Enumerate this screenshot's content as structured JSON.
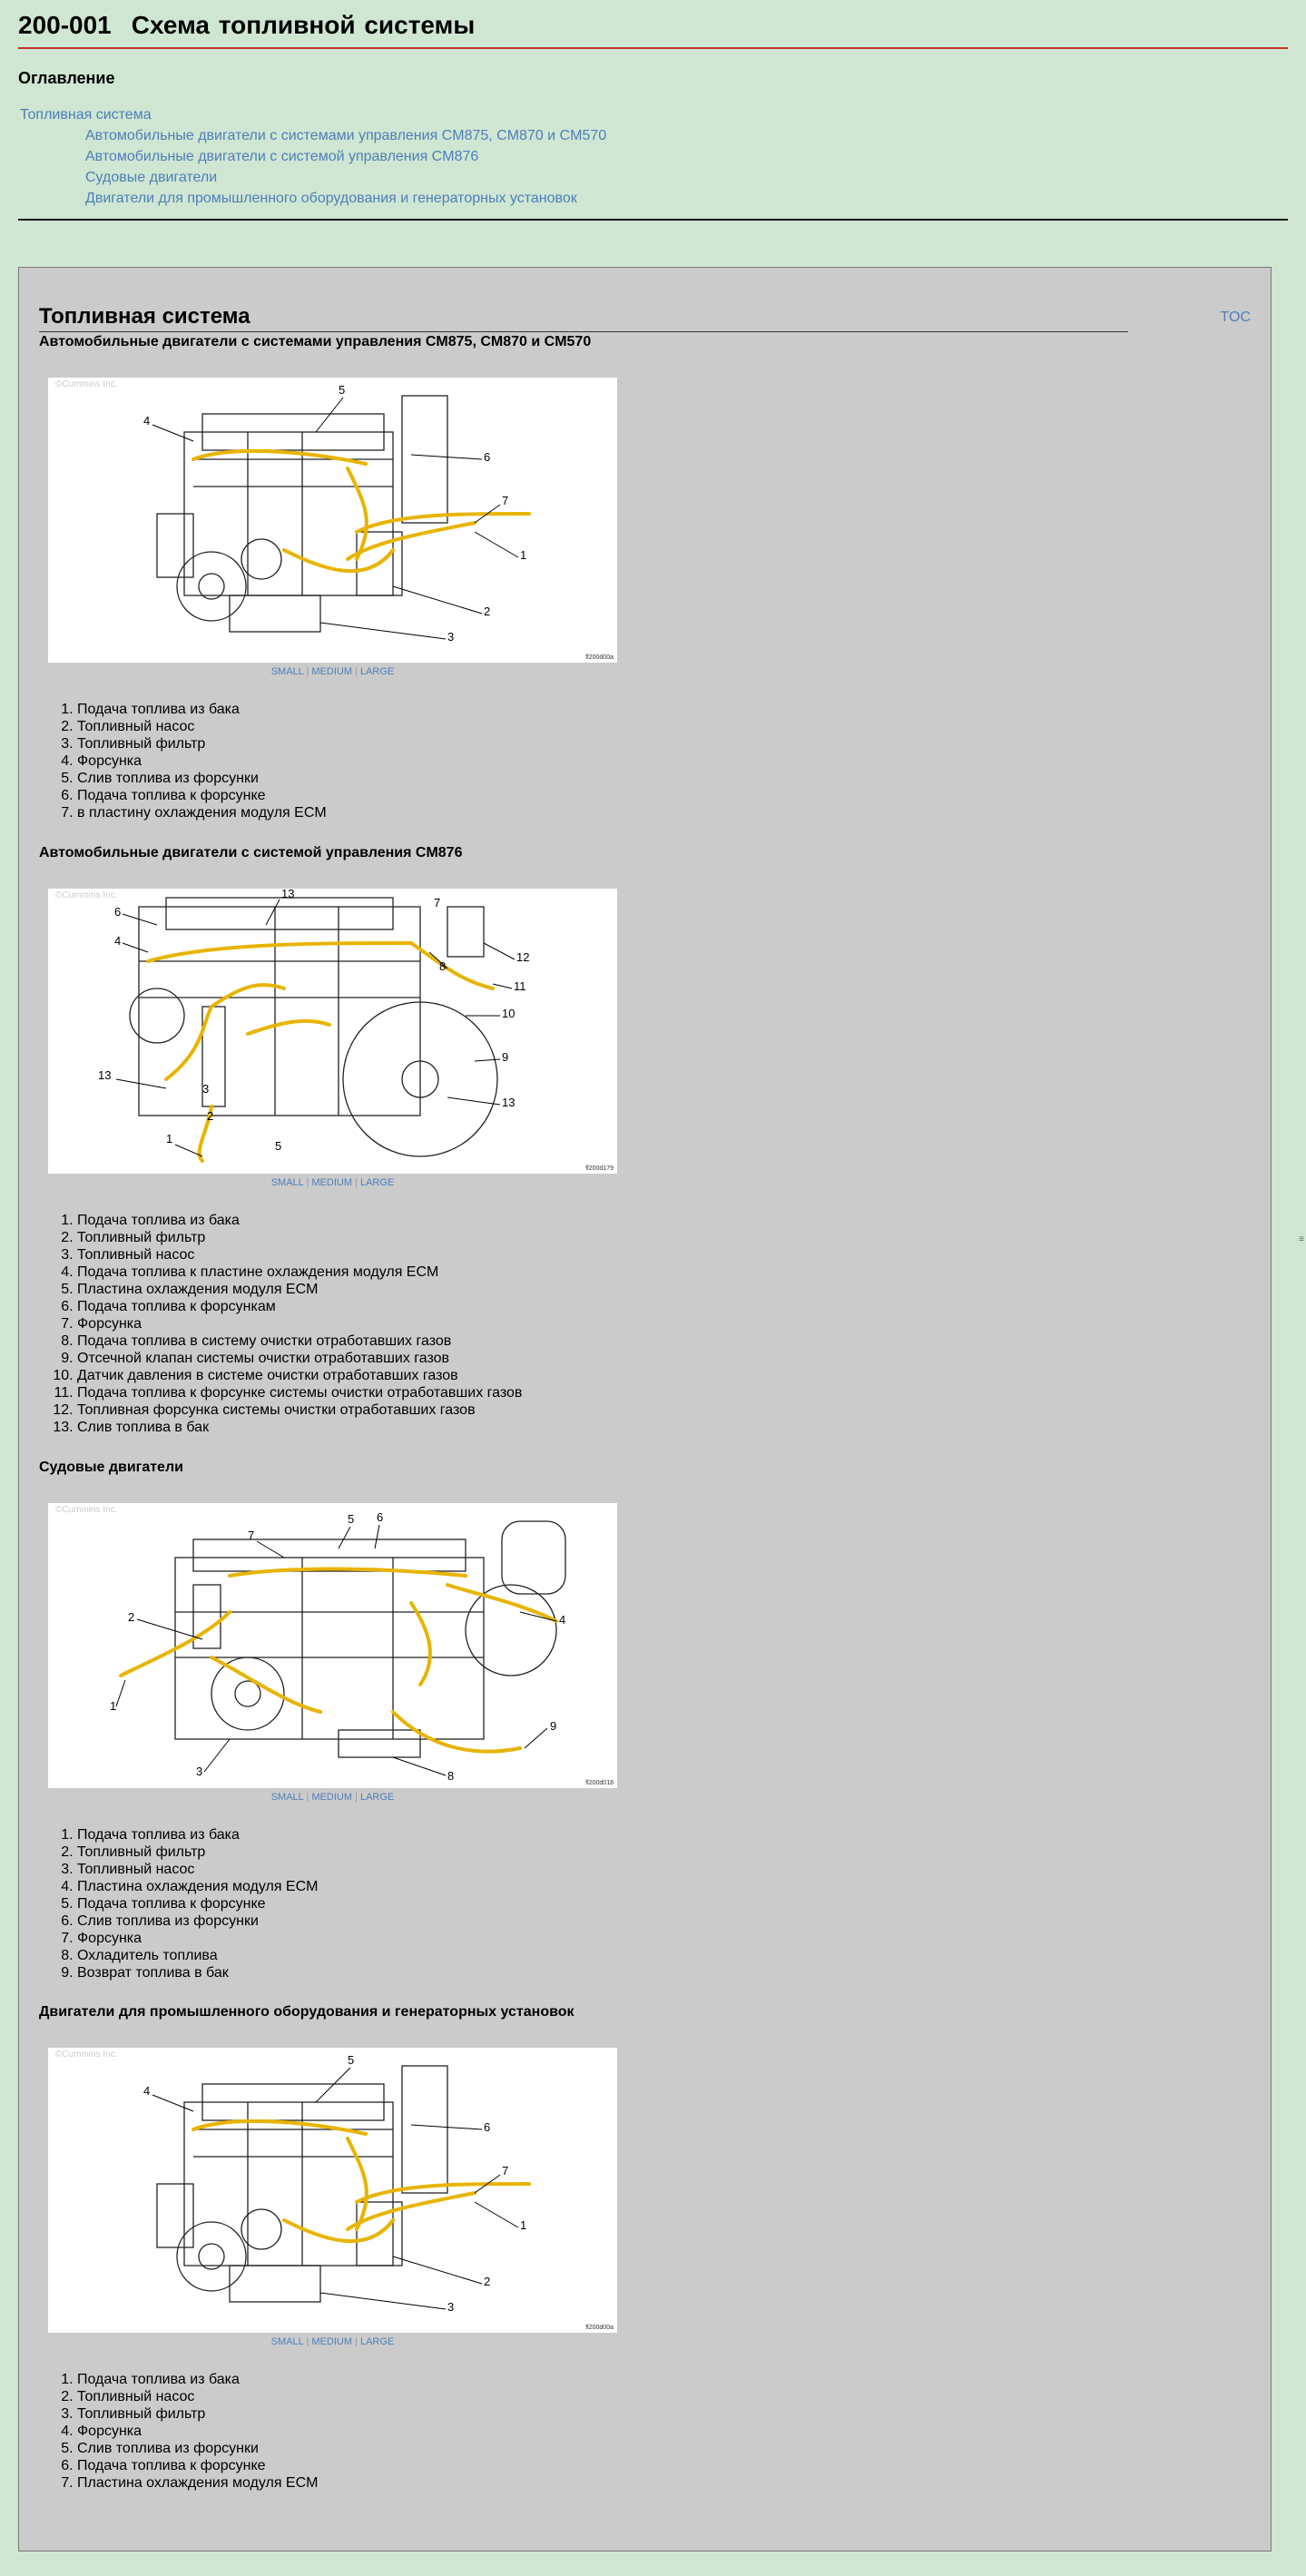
{
  "document": {
    "code": "200-001",
    "title": "Схема топливной системы"
  },
  "toc": {
    "heading": "Оглавление",
    "items": [
      {
        "label": "Топливная система",
        "level": 1
      },
      {
        "label": "Автомобильные двигатели с системами управления CM875, CM870 и CM570",
        "level": 2
      },
      {
        "label": "Автомобильные двигатели с системой управления CM876",
        "level": 2
      },
      {
        "label": "Судовые двигатели",
        "level": 2
      },
      {
        "label": "Двигатели для промышленного оборудования и генераторных установок",
        "level": 2
      }
    ]
  },
  "section": {
    "title": "Топливная система",
    "toc_link": "TOC"
  },
  "size_links": {
    "small": "SMALL",
    "medium": "MEDIUM",
    "large": "LARGE",
    "sep": "|"
  },
  "watermark": "©Cummins Inc.",
  "subsections": [
    {
      "title": "Автомобильные двигатели с системами управления CM875, CM870 и CM570",
      "figure_code": "fl200d00a",
      "callouts": [
        "1",
        "2",
        "3",
        "4",
        "5",
        "6",
        "7"
      ],
      "legend": [
        "Подача топлива из бака",
        "Топливный насос",
        "Топливный фильтр",
        "Форсунка",
        "Слив топлива из форсунки",
        "Подача топлива к форсунке",
        "в пластину охлаждения модуля ECM"
      ]
    },
    {
      "title": "Автомобильные двигатели с системой управления CM876",
      "figure_code": "fl200d179",
      "callouts": [
        "1",
        "2",
        "3",
        "4",
        "5",
        "6",
        "7",
        "8",
        "9",
        "10",
        "11",
        "12",
        "13",
        "13"
      ],
      "legend": [
        "Подача топлива из бака",
        "Топливный фильтр",
        "Топливный насос",
        "Подача топлива к пластине охлаждения модуля ECM",
        "Пластина охлаждения модуля ECM",
        "Подача топлива к форсункам",
        "Форсунка",
        "Подача топлива в систему очистки отработавших газов",
        "Отсечной клапан системы очистки отработавших газов",
        "Датчик давления в системе очистки отработавших газов",
        "Подача топлива к форсунке системы очистки отработавших газов",
        "Топливная форсунка системы очистки отработавших газов",
        "Слив топлива в бак"
      ]
    },
    {
      "title": "Судовые двигатели",
      "figure_code": "fl200d018",
      "callouts": [
        "1",
        "2",
        "3",
        "4",
        "5",
        "6",
        "7",
        "8",
        "9"
      ],
      "legend": [
        "Подача топлива из бака",
        "Топливный фильтр",
        "Топливный насос",
        "Пластина охлаждения модуля ECM",
        "Подача топлива к форсунке",
        "Слив топлива из форсунки",
        "Форсунка",
        "Охладитель топлива",
        "Возврат топлива в бак"
      ]
    },
    {
      "title": "Двигатели для промышленного оборудования и генераторных установок",
      "figure_code": "fl200d00a",
      "callouts": [
        "1",
        "2",
        "3",
        "4",
        "5",
        "6",
        "7"
      ],
      "legend": [
        "Подача топлива из бака",
        "Топливный насос",
        "Топливный фильтр",
        "Форсунка",
        "Слив топлива из форсунки",
        "Подача топлива к форсунке",
        "Пластина охлаждения модуля ECM"
      ]
    }
  ],
  "colors": {
    "background": "#cfe6d2",
    "panel": "#cbcbcb",
    "link": "#4f7fb9",
    "title_rule": "#c4312a",
    "fuel_line": "#e8b400"
  }
}
